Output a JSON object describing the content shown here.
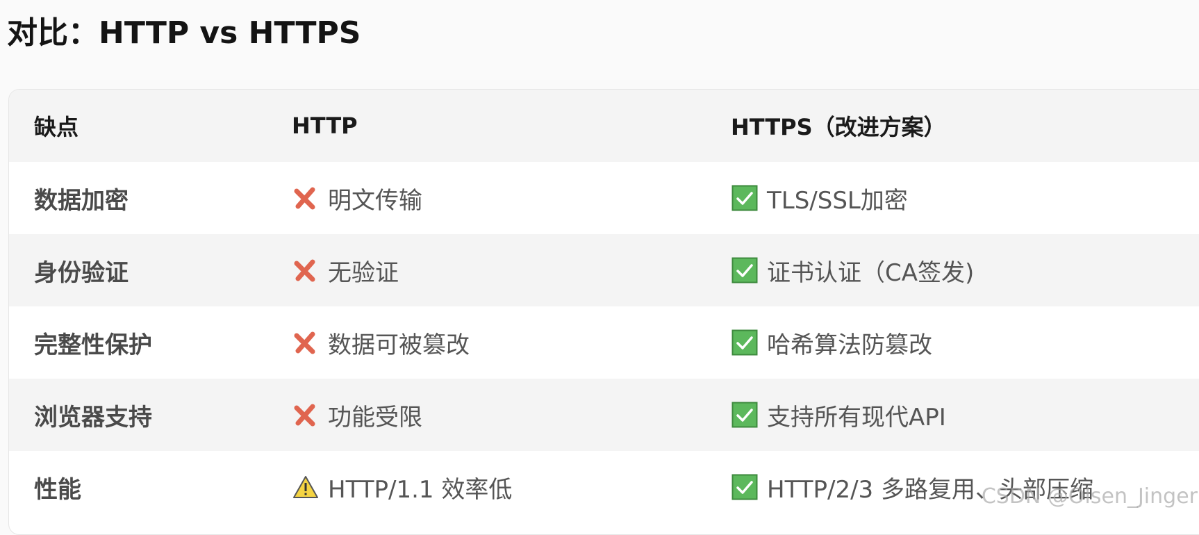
{
  "page": {
    "title": "对比：HTTP vs HTTPS"
  },
  "table": {
    "headers": [
      "缺点",
      "HTTP",
      "HTTPS（改进方案）"
    ],
    "rows": [
      {
        "feature": "数据加密",
        "http": {
          "icon": "cross-icon",
          "text": "明文传输"
        },
        "https": {
          "icon": "check-icon",
          "text": "TLS/SSL加密"
        }
      },
      {
        "feature": "身份验证",
        "http": {
          "icon": "cross-icon",
          "text": "无验证"
        },
        "https": {
          "icon": "check-icon",
          "text": "证书认证（CA签发)"
        }
      },
      {
        "feature": "完整性保护",
        "http": {
          "icon": "cross-icon",
          "text": "数据可被篡改"
        },
        "https": {
          "icon": "check-icon",
          "text": "哈希算法防篡改"
        }
      },
      {
        "feature": "浏览器支持",
        "http": {
          "icon": "cross-icon",
          "text": "功能受限"
        },
        "https": {
          "icon": "check-icon",
          "text": "支持所有现代API"
        }
      },
      {
        "feature": "性能",
        "http": {
          "icon": "warning-icon",
          "text": "HTTP/1.1 效率低"
        },
        "https": {
          "icon": "check-icon",
          "text": "HTTP/2/3 多路复用、头部压缩"
        }
      }
    ]
  },
  "colors": {
    "cross": "#e0654f",
    "check_bg": "#5cb85c",
    "warning": "#f5d442"
  },
  "watermark": "CSDN @Olsen_Jinger"
}
